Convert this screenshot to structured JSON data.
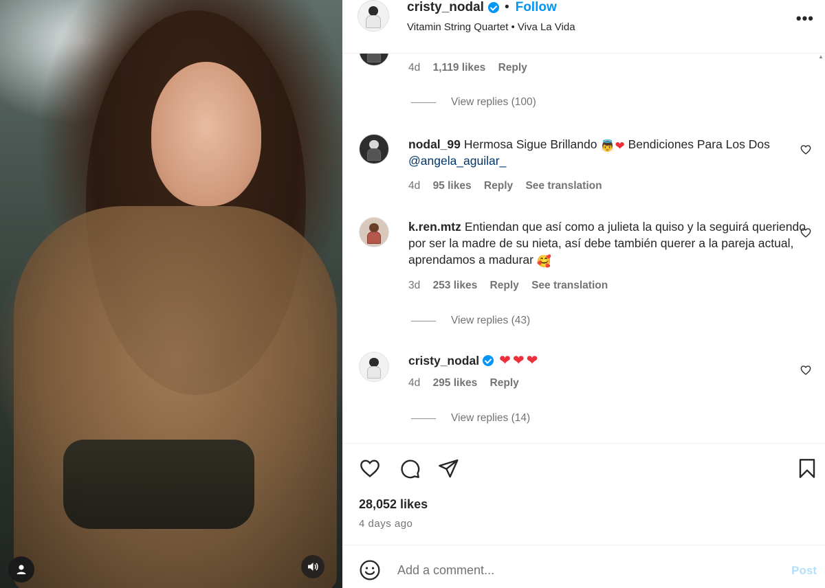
{
  "post": {
    "username": "cristy_nodal",
    "follow_label": "Follow",
    "separator": "•",
    "audio": "Vitamin String Quartet • Viva La Vida",
    "more_label": "•••",
    "likes": "28,052 likes",
    "time": "4 days ago"
  },
  "comments": {
    "first_meta": {
      "age": "4d",
      "likes": "1,119 likes",
      "reply": "Reply"
    },
    "first_replies": "View replies (100)",
    "items": [
      {
        "username": "nodal_99",
        "text_a": "Hermosa Sigue Brillando",
        "text_b": "Bendiciones Para Los Dos",
        "mention": "@angela_aguilar_",
        "age": "4d",
        "likes": "95 likes",
        "reply": "Reply",
        "translate": "See translation"
      },
      {
        "username": "k.ren.mtz",
        "text": "Entiendan que así como a julieta la quiso y la seguirá queriendo por ser la madre de su nieta, así debe también querer a la pareja actual, aprendamos a madurar",
        "age": "3d",
        "likes": "253 likes",
        "reply": "Reply",
        "translate": "See translation",
        "replies": "View replies (43)"
      },
      {
        "username": "cristy_nodal",
        "text": "❤❤❤",
        "age": "4d",
        "likes": "295 likes",
        "reply": "Reply",
        "replies": "View replies (14)"
      }
    ]
  },
  "composer": {
    "placeholder": "Add a comment...",
    "post_label": "Post"
  },
  "icons": {
    "like": "heart-icon",
    "comment": "comment-bubble-icon",
    "share": "paper-plane-icon",
    "save": "bookmark-icon",
    "emoji": "smiley-icon",
    "verified": "verified-badge-icon"
  },
  "colors": {
    "accent": "#0095f6",
    "mention": "#00376b",
    "muted": "#737373",
    "post_disabled": "#b2dffc"
  }
}
